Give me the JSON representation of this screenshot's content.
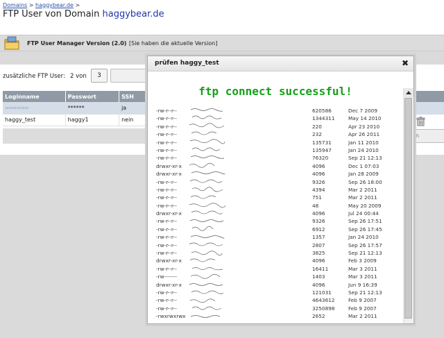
{
  "breadcrumb": {
    "root": "Domains",
    "sep1": ">",
    "domain": "haggybear.de",
    "sep2": ">"
  },
  "page": {
    "title_prefix": "FTP User von Domain",
    "title_domain": "haggybear.de"
  },
  "manager": {
    "name": "FTP User Manager Version (2.0)",
    "note": "[Sie haben die aktuelle Version]"
  },
  "extra": {
    "label": "zusätzliche FTP User:",
    "count": "2 von",
    "max": "3"
  },
  "table": {
    "headers": [
      "Loginname",
      "Passwort",
      "SSH"
    ],
    "rows": [
      {
        "login": "≈≈≈≈≈≈",
        "password": "******",
        "ssh": "ja"
      },
      {
        "login": "haggy_test",
        "password": "haggy1",
        "ssh": "nein"
      }
    ],
    "right_button": "n"
  },
  "modal": {
    "title": "prüfen haggy_test",
    "close": "✖",
    "message": "ftp connect successful!",
    "listing": [
      {
        "perm": "-rw-r--r--",
        "size": "620586",
        "date": "Dec 7 2009"
      },
      {
        "perm": "-rw-r--r--",
        "size": "1344311",
        "date": "May 14 2010"
      },
      {
        "perm": "-rw-r--r--",
        "size": "220",
        "date": "Apr 23 2010"
      },
      {
        "perm": "-rw-r--r--",
        "size": "232",
        "date": "Apr 26 2011"
      },
      {
        "perm": "-rw-r--r--",
        "size": "135731",
        "date": "Jan 11 2010"
      },
      {
        "perm": "-rw-r--r--",
        "size": "135947",
        "date": "Jan 24 2010"
      },
      {
        "perm": "-rw-r--r--",
        "size": "76320",
        "date": "Sep 21 12:13"
      },
      {
        "perm": "drwxr-xr-x",
        "size": "4096",
        "date": "Dec 1 07:03"
      },
      {
        "perm": "drwxr-xr-x",
        "size": "4096",
        "date": "Jan 28 2009"
      },
      {
        "perm": "-rw-r--r--",
        "size": "9326",
        "date": "Sep 26 18:00"
      },
      {
        "perm": "-rw-r--r--",
        "size": "4394",
        "date": "Mar 2 2011"
      },
      {
        "perm": "-rw-r--r--",
        "size": "751",
        "date": "Mar 2 2011"
      },
      {
        "perm": "-rw-r--r--",
        "size": "48",
        "date": "May 20 2009"
      },
      {
        "perm": "drwxr-xr-x",
        "size": "4096",
        "date": "Jul 24 00:44"
      },
      {
        "perm": "-rw-r--r--",
        "size": "9326",
        "date": "Sep 26 17:51"
      },
      {
        "perm": "-rw-r--r--",
        "size": "6912",
        "date": "Sep 26 17:45"
      },
      {
        "perm": "-rw-r--r--",
        "size": "1357",
        "date": "Jan 24 2010"
      },
      {
        "perm": "-rw-r--r--",
        "size": "2807",
        "date": "Sep 26 17:57"
      },
      {
        "perm": "-rw-r--r--",
        "size": "3825",
        "date": "Sep 21 12:13"
      },
      {
        "perm": "drwxr-xr-x",
        "size": "4096",
        "date": "Feb 3 2009"
      },
      {
        "perm": "-rw-r--r--",
        "size": "16411",
        "date": "Mar 3 2011"
      },
      {
        "perm": "-rw-------",
        "size": "1403",
        "date": "Mar 3 2011"
      },
      {
        "perm": "drwxr-xr-x",
        "size": "4096",
        "date": "Jun 9 16:39"
      },
      {
        "perm": "-rw-r--r--",
        "size": "121031",
        "date": "Sep 21 12:13"
      },
      {
        "perm": "-rw-r--r--",
        "size": "4643612",
        "date": "Feb 9 2007"
      },
      {
        "perm": "-rw-r--r--",
        "size": "3250898",
        "date": "Feb 9 2007"
      },
      {
        "perm": "-rwxrwxrwx",
        "size": "2652",
        "date": "Mar 2 2011"
      }
    ]
  },
  "colors": {
    "success": "#16a01a",
    "link": "#2a52a8",
    "table_header": "#8f9aa6",
    "row_highlight": "#d4dde8"
  },
  "icons": {
    "folder": "folder-icon",
    "trash": "trash-icon",
    "close": "close-icon"
  }
}
